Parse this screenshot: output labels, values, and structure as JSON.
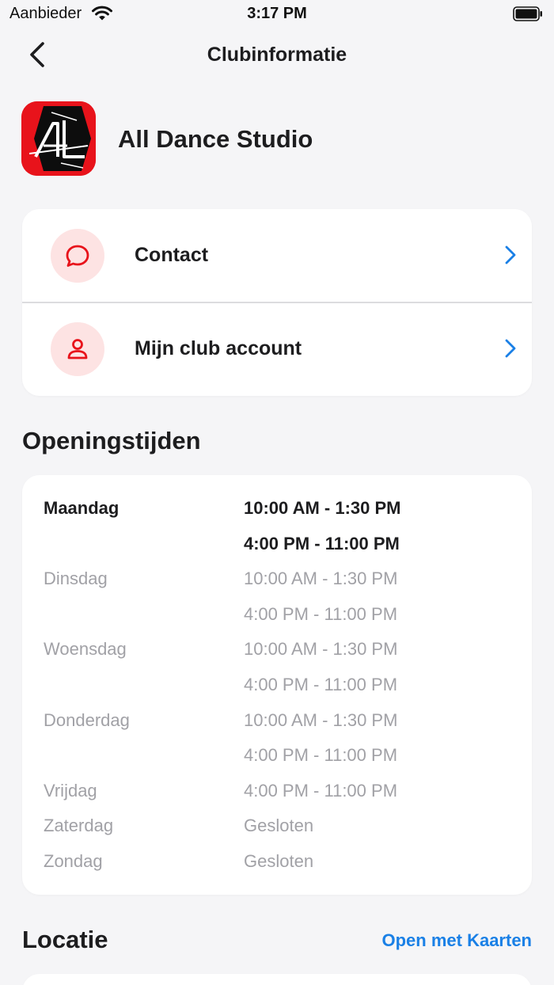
{
  "status_bar": {
    "carrier": "Aanbieder",
    "time": "3:17 PM"
  },
  "nav": {
    "title": "Clubinformatie"
  },
  "club": {
    "name": "All Dance Studio"
  },
  "menu": {
    "items": [
      {
        "label": "Contact",
        "icon": "chat-bubble-icon"
      },
      {
        "label": "Mijn club account",
        "icon": "user-icon"
      }
    ]
  },
  "opening_hours": {
    "title": "Openingstijden",
    "rows": [
      {
        "day": "Maandag",
        "time": "10:00 AM - 1:30 PM",
        "today": true
      },
      {
        "day": "",
        "time": "4:00 PM - 11:00 PM",
        "today": true
      },
      {
        "day": "Dinsdag",
        "time": "10:00 AM - 1:30 PM"
      },
      {
        "day": "",
        "time": "4:00 PM - 11:00 PM"
      },
      {
        "day": "Woensdag",
        "time": "10:00 AM - 1:30 PM"
      },
      {
        "day": "",
        "time": "4:00 PM - 11:00 PM"
      },
      {
        "day": "Donderdag",
        "time": "10:00 AM - 1:30 PM"
      },
      {
        "day": "",
        "time": "4:00 PM - 11:00 PM"
      },
      {
        "day": "Vrijdag",
        "time": "4:00 PM - 11:00 PM"
      },
      {
        "day": "Zaterdag",
        "time": "Gesloten"
      },
      {
        "day": "Zondag",
        "time": "Gesloten"
      }
    ]
  },
  "location": {
    "title": "Locatie",
    "open_maps_label": "Open met Kaarten"
  },
  "colors": {
    "accent_blue": "#1a80e6",
    "brand_red": "#e8131b",
    "icon_bg": "#fde3e3",
    "muted_text": "#a1a1a6",
    "background": "#f5f5f7"
  }
}
